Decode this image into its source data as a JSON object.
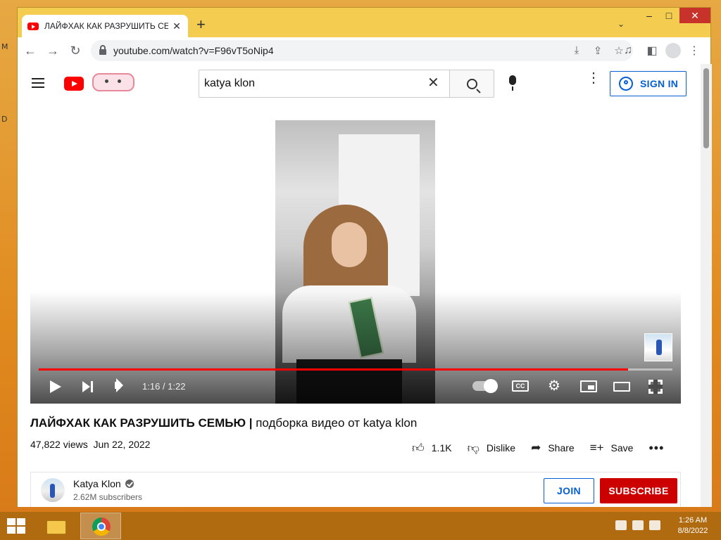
{
  "desktop": {
    "letters": [
      "M",
      "D"
    ]
  },
  "browser": {
    "tab": {
      "title": "ЛАЙФХАК КАК РАЗРУШИТЬ СЕМЬЮ",
      "close": "✕"
    },
    "new_tab": "+",
    "tab_search": "⌄",
    "window_controls": {
      "minimize": "–",
      "maximize": "□",
      "close": "✕"
    },
    "nav": {
      "back": "←",
      "forward": "→",
      "reload": "↻"
    },
    "url": "youtube.com/watch?v=F96vT5oNip4"
  },
  "youtube": {
    "search": {
      "value": "katya klon",
      "clear": "✕"
    },
    "more": "⋮",
    "sign_in_label": "SIGN IN",
    "player": {
      "time": "1:16 / 1:22",
      "progress_fraction": 0.93,
      "cc_label": "CC",
      "settings": "⚙"
    },
    "video": {
      "title_prefix": "ЛАЙФХАК КАК РАЗРУШИТЬ СЕМЬЮ |",
      "title_suffix": " подборка видео от katya klon",
      "views": "47,822 views",
      "date": "Jun 22, 2022"
    },
    "actions": {
      "like_count": "1.1K",
      "dislike_label": "Dislike",
      "share_label": "Share",
      "save_label": "Save",
      "more": "•••"
    },
    "channel": {
      "name": "Katya Klon",
      "subscribers": "2.62M subscribers",
      "join_label": "JOIN",
      "subscribe_label": "SUBSCRIBE"
    }
  },
  "taskbar": {
    "time": "1:26 AM",
    "date": "8/8/2022"
  },
  "colors": {
    "accent_blue": "#065fd4",
    "youtube_red": "#ff0000",
    "subscribe_red": "#cc0000",
    "window_frame": "#f0c54b",
    "taskbar": "#b06a10"
  }
}
